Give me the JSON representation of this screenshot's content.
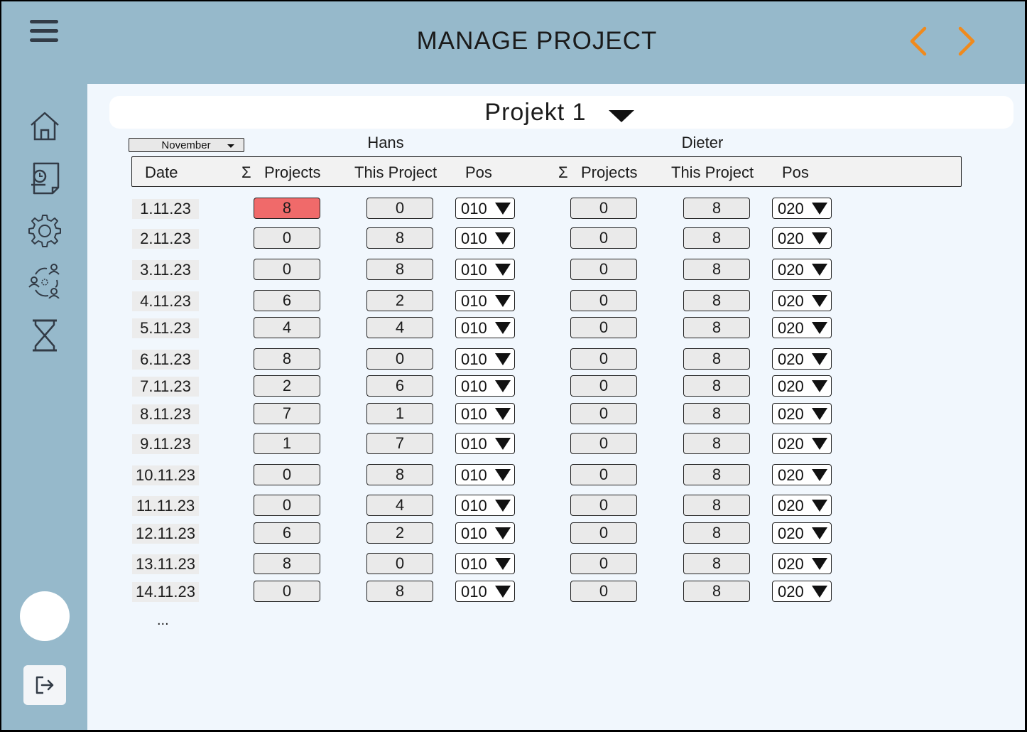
{
  "header": {
    "title": "MANAGE PROJECT"
  },
  "project": {
    "name": "Projekt 1"
  },
  "month_select": {
    "value": "November"
  },
  "people": [
    {
      "name": "Hans",
      "default_pos": "010"
    },
    {
      "name": "Dieter",
      "default_pos": "020"
    }
  ],
  "columns": [
    "Date",
    "Projects",
    "This Project",
    "Pos",
    "Projects",
    "This Project",
    "Pos"
  ],
  "sigma": "Σ",
  "rows": [
    {
      "date": "1.11.23",
      "hans": {
        "projects": "8",
        "this": "0",
        "pos": "010",
        "alert": true
      },
      "dieter": {
        "projects": "0",
        "this": "8",
        "pos": "020"
      }
    },
    {
      "date": "2.11.23",
      "hans": {
        "projects": "0",
        "this": "8",
        "pos": "010"
      },
      "dieter": {
        "projects": "0",
        "this": "8",
        "pos": "020"
      }
    },
    {
      "date": "3.11.23",
      "hans": {
        "projects": "0",
        "this": "8",
        "pos": "010"
      },
      "dieter": {
        "projects": "0",
        "this": "8",
        "pos": "020"
      }
    },
    {
      "date": "4.11.23",
      "hans": {
        "projects": "6",
        "this": "2",
        "pos": "010"
      },
      "dieter": {
        "projects": "0",
        "this": "8",
        "pos": "020"
      }
    },
    {
      "date": "5.11.23",
      "hans": {
        "projects": "4",
        "this": "4",
        "pos": "010"
      },
      "dieter": {
        "projects": "0",
        "this": "8",
        "pos": "020"
      }
    },
    {
      "date": "6.11.23",
      "hans": {
        "projects": "8",
        "this": "0",
        "pos": "010"
      },
      "dieter": {
        "projects": "0",
        "this": "8",
        "pos": "020"
      }
    },
    {
      "date": "7.11.23",
      "hans": {
        "projects": "2",
        "this": "6",
        "pos": "010"
      },
      "dieter": {
        "projects": "0",
        "this": "8",
        "pos": "020"
      }
    },
    {
      "date": "8.11.23",
      "hans": {
        "projects": "7",
        "this": "1",
        "pos": "010"
      },
      "dieter": {
        "projects": "0",
        "this": "8",
        "pos": "020"
      }
    },
    {
      "date": "9.11.23",
      "hans": {
        "projects": "1",
        "this": "7",
        "pos": "010"
      },
      "dieter": {
        "projects": "0",
        "this": "8",
        "pos": "020"
      }
    },
    {
      "date": "10.11.23",
      "hans": {
        "projects": "0",
        "this": "8",
        "pos": "010"
      },
      "dieter": {
        "projects": "0",
        "this": "8",
        "pos": "020"
      }
    },
    {
      "date": "11.11.23",
      "hans": {
        "projects": "0",
        "this": "4",
        "pos": "010"
      },
      "dieter": {
        "projects": "0",
        "this": "8",
        "pos": "020"
      }
    },
    {
      "date": "12.11.23",
      "hans": {
        "projects": "6",
        "this": "2",
        "pos": "010"
      },
      "dieter": {
        "projects": "0",
        "this": "8",
        "pos": "020"
      }
    },
    {
      "date": "13.11.23",
      "hans": {
        "projects": "8",
        "this": "0",
        "pos": "010"
      },
      "dieter": {
        "projects": "0",
        "this": "8",
        "pos": "020"
      }
    },
    {
      "date": "14.11.23",
      "hans": {
        "projects": "0",
        "this": "8",
        "pos": "010"
      },
      "dieter": {
        "projects": "0",
        "this": "8",
        "pos": "020"
      }
    }
  ],
  "more": "...",
  "sidebar": [
    "home-icon",
    "timesheet-icon",
    "settings-icon",
    "team-icon",
    "hourglass-icon"
  ],
  "colors": {
    "sidebar_bg": "#96b9cb",
    "content_bg": "#f1f7fd",
    "accent_arrows": "#f08a1c",
    "alert_cell": "#f06a6a"
  }
}
